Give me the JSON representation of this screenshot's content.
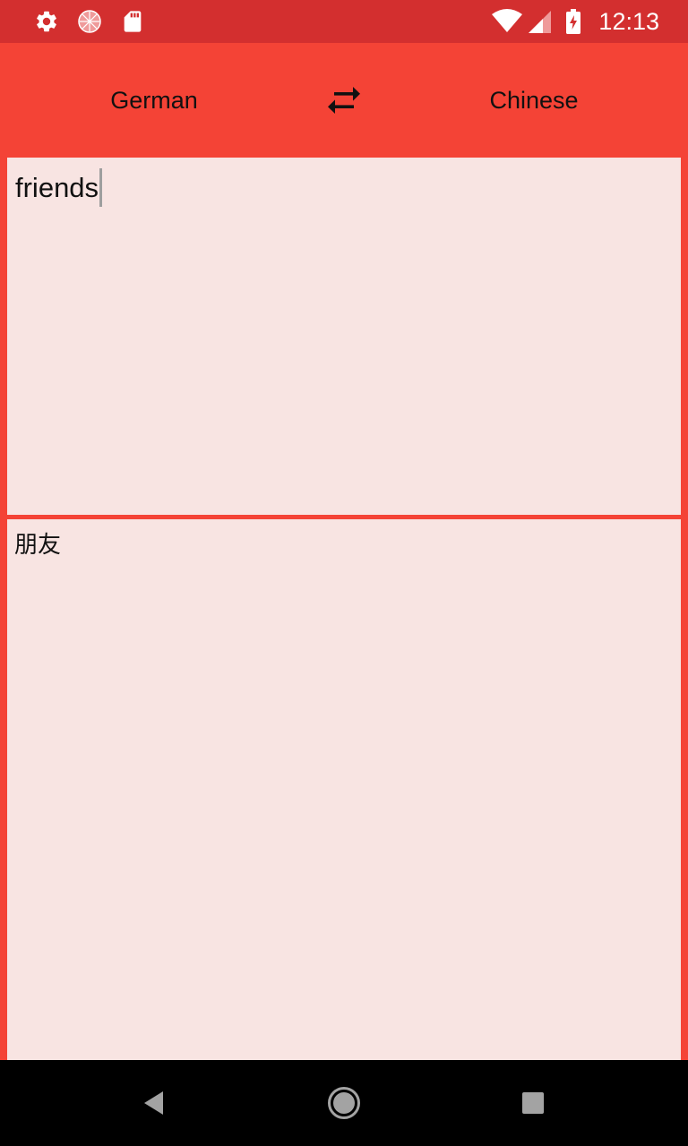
{
  "status_bar": {
    "time": "12:13",
    "icons": [
      "settings-icon",
      "loading-circle-icon",
      "sd-card-icon",
      "wifi-icon",
      "cell-signal-icon",
      "battery-charging-icon"
    ],
    "background": "#d32f2f"
  },
  "toolbar": {
    "source_language": "German",
    "target_language": "Chinese",
    "swap_icon": "swap-arrows-icon",
    "background": "#f44336"
  },
  "translator": {
    "input_text": "friends",
    "output_text": "朋友",
    "panel_color": "#f8e4e2"
  },
  "nav_bar": {
    "buttons": [
      "back-icon",
      "home-icon",
      "recents-icon"
    ]
  }
}
